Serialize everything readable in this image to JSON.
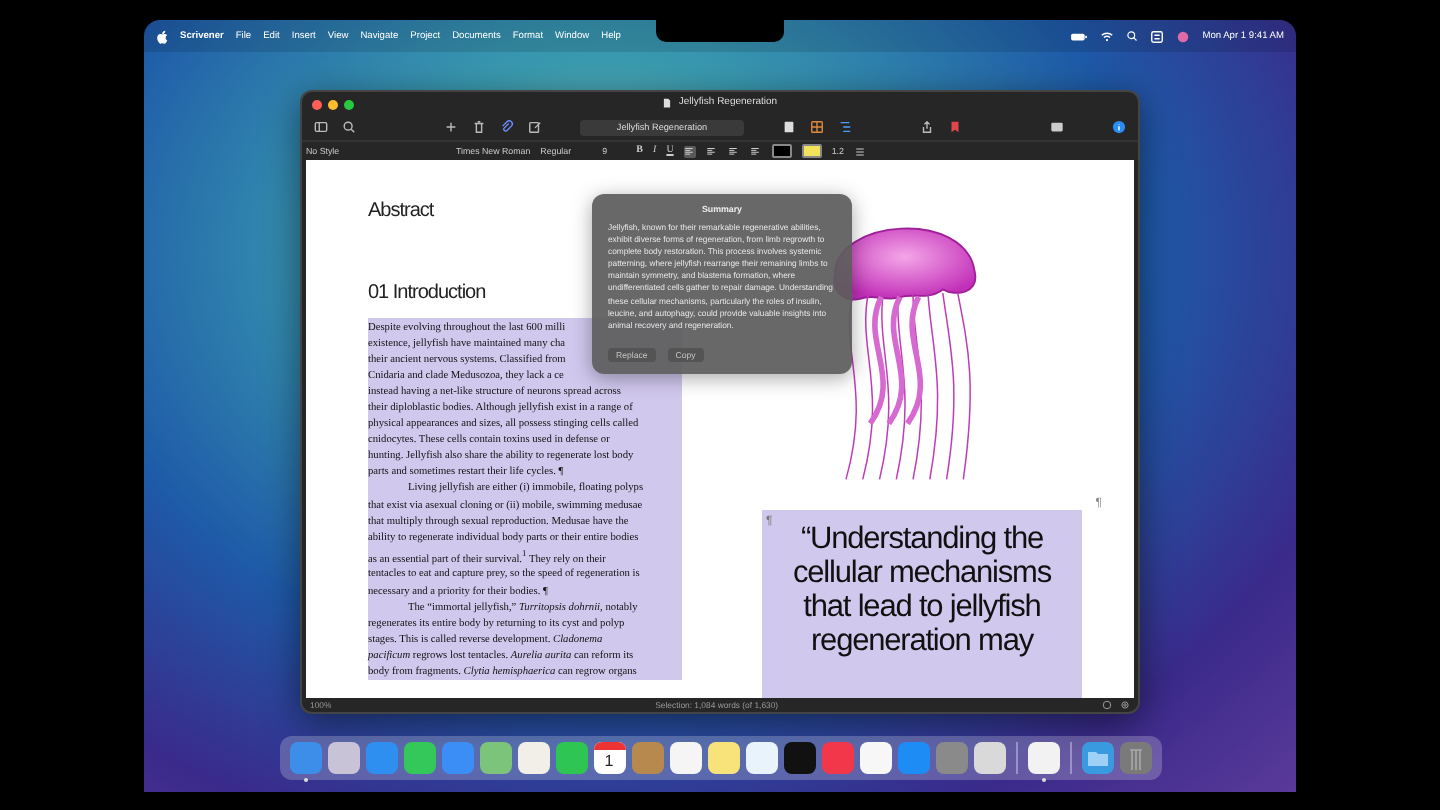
{
  "menu_bar": {
    "app": "Scrivener",
    "items": [
      "File",
      "Edit",
      "Insert",
      "View",
      "Navigate",
      "Project",
      "Documents",
      "Format",
      "Window",
      "Help"
    ],
    "clock": "Mon Apr 1  9:41 AM"
  },
  "window": {
    "title": "Jellyfish Regeneration",
    "search_field": "Jellyfish Regeneration",
    "format_bar": {
      "style": "No Style",
      "font": "Times New Roman",
      "weight": "Regular",
      "size": "9",
      "bold": "B",
      "italic": "I",
      "underline": "U",
      "line_spacing": "1.2",
      "alignment": [
        {
          "selected": true
        },
        {
          "selected": false
        },
        {
          "selected": false
        },
        {
          "selected": false
        }
      ]
    },
    "document": {
      "headings": [
        "Abstract",
        "01 Introduction"
      ],
      "body_lines": [
        {
          "kind": "line",
          "text": "Despite evolving throughout the last 600 milli"
        },
        {
          "kind": "line",
          "text": "existence, jellyfish have maintained many cha"
        },
        {
          "kind": "line",
          "text": "their ancient nervous systems. Classified from"
        },
        {
          "kind": "line",
          "text": "Cnidaria and clade Medusozoa, they lack a ce"
        },
        {
          "kind": "line",
          "text": "instead having a net-like structure of neurons spread across"
        },
        {
          "kind": "line",
          "text": "their diploblastic bodies. Although jellyfish exist in a range of"
        },
        {
          "kind": "line",
          "text": "physical appearances and sizes, all possess stinging cells called"
        },
        {
          "kind": "line",
          "text": "cnidocytes. These cells contain toxins used in defense or"
        },
        {
          "kind": "line",
          "text": "hunting. Jellyfish also share the ability to regenerate lost body"
        },
        {
          "kind": "line",
          "text": "parts and sometimes restart their life cycles. ¶"
        },
        {
          "kind": "first",
          "text": "Living jellyfish are either (i) immobile, floating polyps"
        },
        {
          "kind": "line",
          "text": "that exist via asexual cloning or (ii) mobile, swimming medusae"
        },
        {
          "kind": "line",
          "text": "that multiply through sexual reproduction. Medusae have the"
        },
        {
          "kind": "line",
          "text": "ability to regenerate individual body parts or their entire bodies"
        },
        {
          "kind": "line",
          "text": "as an essential part of their survival.$^{1}$ They rely on their"
        },
        {
          "kind": "line",
          "text": "tentacles to eat and capture prey, so the speed of regeneration is"
        },
        {
          "kind": "line",
          "text": "necessary and a priority for their bodies. ¶"
        },
        {
          "kind": "first",
          "text": "The “immortal jellyfish,” *Turritopsis dohrnii*, notably"
        },
        {
          "kind": "line",
          "text": "regenerates its entire body by returning to its cyst and polyp"
        },
        {
          "kind": "line",
          "text": "stages. This is called reverse development. *Cladonema*"
        },
        {
          "kind": "line",
          "text": "*pacificum* regrows lost tentacles. *Aurelia aurita* can reform its"
        },
        {
          "kind": "line",
          "text": "body from fragments. *Clytia hemisphaerica* can regrow organs"
        }
      ],
      "pilcrows": [
        "¶",
        "¶"
      ],
      "quote": "“Understanding the cellular mechanisms that lead to jellyfish regeneration may",
      "summary": {
        "title": "Summary",
        "text": "Jellyfish, known for their remarkable regenerative abilities, exhibit diverse forms of regeneration, from limb regrowth to complete body restoration. This process involves systemic patterning, where jellyfish rearrange their remaining limbs to maintain symmetry, and blastema formation, where undifferentiated cells gather to repair damage. Understanding these cellular mechanisms, particularly the roles of insulin, leucine, and autophagy, could provide valuable insights into animal recovery and regeneration.",
        "buttons": [
          {
            "label": "Replace",
            "disabled": true
          },
          {
            "label": "Copy",
            "disabled": true
          }
        ]
      }
    },
    "footer": {
      "zoom": "100%",
      "selection": "Selection: 1,084 words (of 1,630)"
    }
  },
  "dock": {
    "apps": [
      {
        "kind": "app",
        "color": "#3d8ee8",
        "running": true
      },
      {
        "kind": "app",
        "color": "#c9c3d8",
        "running": false
      },
      {
        "kind": "app",
        "color": "#2f8ff0",
        "running": false
      },
      {
        "kind": "app",
        "color": "#34c759",
        "running": false
      },
      {
        "kind": "app",
        "color": "#3a8ef6",
        "running": false
      },
      {
        "kind": "app",
        "color": "#7cc47a",
        "running": false
      },
      {
        "kind": "app",
        "color": "#f2eee8",
        "running": false
      },
      {
        "kind": "app",
        "color": "#2fc552",
        "running": false
      },
      {
        "kind": "calendar",
        "color": "#ffffff",
        "label": "1",
        "running": false
      },
      {
        "kind": "app",
        "color": "#b8894e",
        "running": false
      },
      {
        "kind": "app",
        "color": "#f5f5f5",
        "running": false
      },
      {
        "kind": "app",
        "color": "#f8e27a",
        "running": false
      },
      {
        "kind": "app",
        "color": "#e9f3fb",
        "running": false
      },
      {
        "kind": "app",
        "color": "#111111",
        "running": false
      },
      {
        "kind": "app",
        "color": "#f3374b",
        "running": false
      },
      {
        "kind": "app",
        "color": "#f7f7f7",
        "running": false
      },
      {
        "kind": "app",
        "color": "#1e8cf5",
        "running": false
      },
      {
        "kind": "app",
        "color": "#8a8a8a",
        "running": false
      },
      {
        "kind": "app",
        "color": "#d9d9d9",
        "running": false
      }
    ],
    "recent": [
      {
        "kind": "app",
        "color": "#f2f2f2",
        "running": true
      }
    ],
    "stacks": [
      {
        "kind": "folder",
        "color": "#3a9ae0",
        "running": false
      },
      {
        "kind": "trash",
        "color": "#7a7a7a",
        "running": false
      }
    ]
  }
}
